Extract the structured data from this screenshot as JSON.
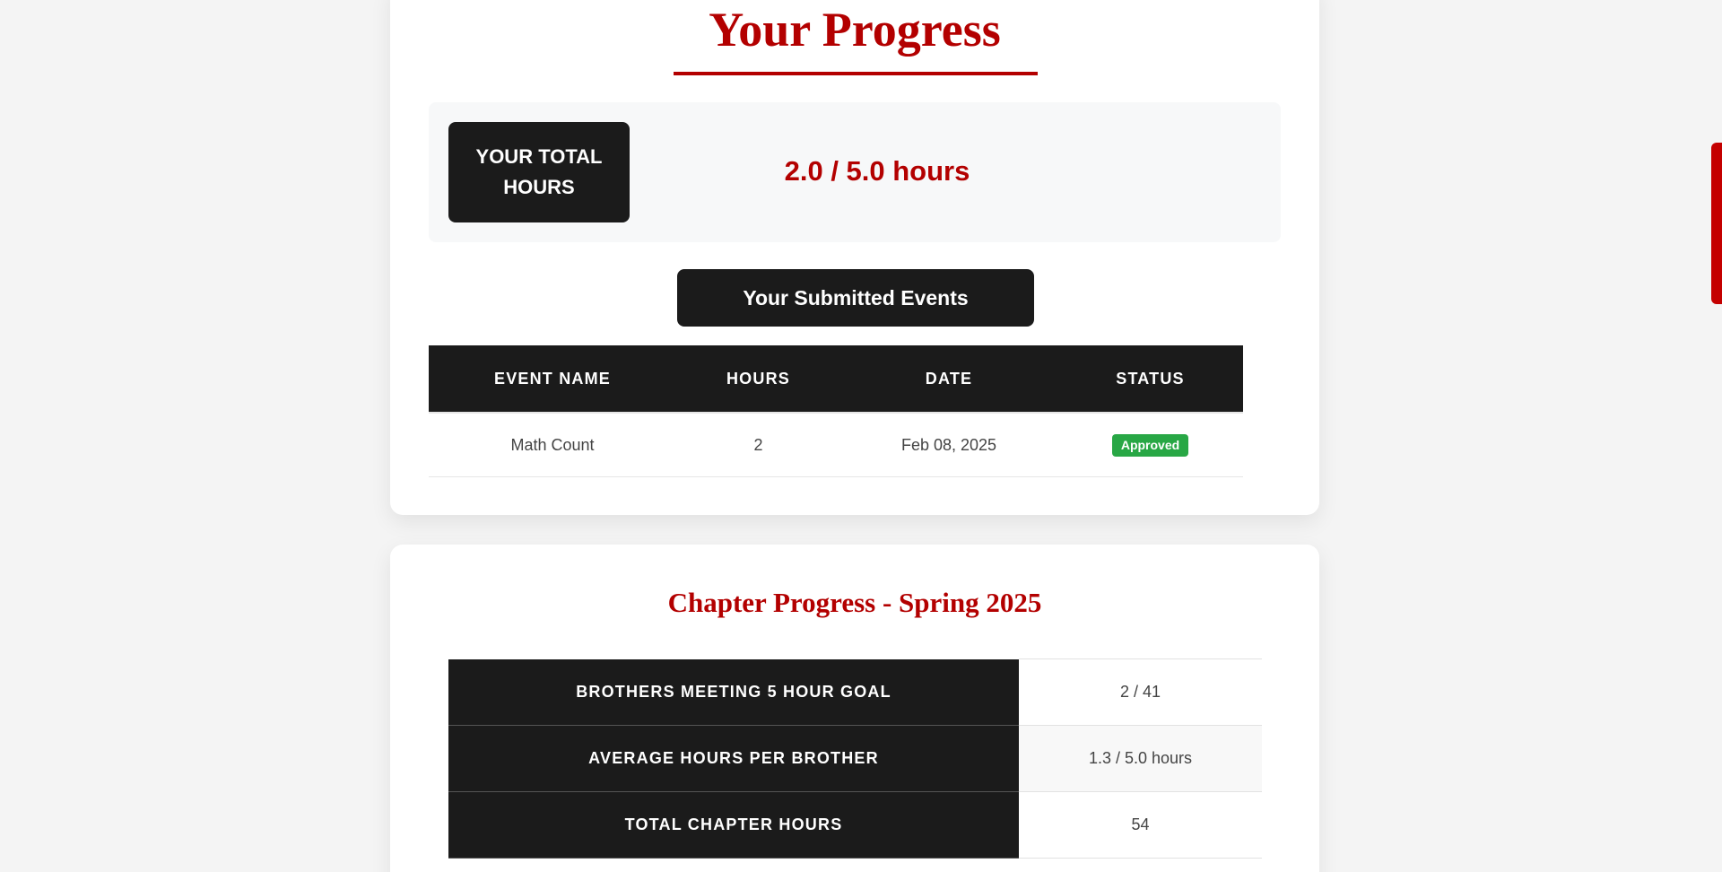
{
  "progress": {
    "title": "Your Progress",
    "total_label": "YOUR TOTAL HOURS",
    "total_value": "2.0 / 5.0 hours",
    "events_heading": "Your Submitted Events",
    "columns": [
      "EVENT NAME",
      "HOURS",
      "DATE",
      "STATUS"
    ],
    "rows": [
      {
        "event": "Math Count",
        "hours": "2",
        "date": "Feb 08, 2025",
        "status": "Approved"
      }
    ]
  },
  "chapter": {
    "title": "Chapter Progress - Spring 2025",
    "rows": [
      {
        "label": "BROTHERS MEETING 5 HOUR GOAL",
        "value": "2 / 41"
      },
      {
        "label": "AVERAGE HOURS PER BROTHER",
        "value": "1.3 / 5.0 hours"
      },
      {
        "label": "TOTAL CHAPTER HOURS",
        "value": "54"
      }
    ]
  },
  "colors": {
    "accent": "#b30000",
    "dark": "#1b1b1b",
    "approved": "#28a745",
    "scrollbar": "#c40000"
  }
}
